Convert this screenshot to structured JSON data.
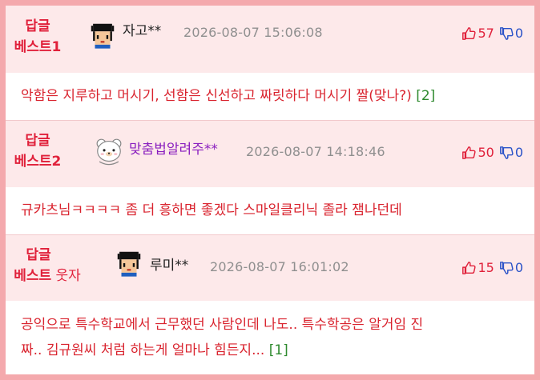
{
  "colors": {
    "accent": "#e0203a",
    "down": "#2b53c8",
    "replies": "#2f8a2f",
    "frame": "#f4a9ad"
  },
  "comments": [
    {
      "badge_line1": "답글",
      "badge_line2": "베스트1",
      "badge_suffix": "",
      "avatar": "pixel-boy-avatar",
      "nickname": "자고**",
      "date": "2026-08-07 15:06:08",
      "up": "57",
      "down": "0",
      "text": "악함은 지루하고 머시기, 선함은 신선하고 짜릿하다 머시기 짤(맞나?)",
      "replies": "[2]"
    },
    {
      "badge_line1": "답글",
      "badge_line2": "베스트2",
      "badge_suffix": "",
      "avatar": "bear-avatar",
      "nickname": "맞춤법알려주**",
      "date": "2026-08-07 14:18:46",
      "up": "50",
      "down": "0",
      "text": "규카츠님ㅋㅋㅋㅋ 좀 더 흥하면 좋겠다 스마일클리닉 졸라 잼나던데",
      "replies": ""
    },
    {
      "badge_line1": "답글",
      "badge_line2": "베스트",
      "badge_suffix": " 웃자",
      "avatar": "pixel-boy-avatar",
      "nickname": "루미**",
      "date": "2026-08-07 16:01:02",
      "up": "15",
      "down": "0",
      "text_line1": "공익으로 특수학교에서 근무했던 사람인데 나도.. 특수학공은 알거임 진",
      "text_line2": "짜.. 김규원씨 처럼 하는게 얼마나 힘든지...",
      "replies": "[1]"
    }
  ]
}
